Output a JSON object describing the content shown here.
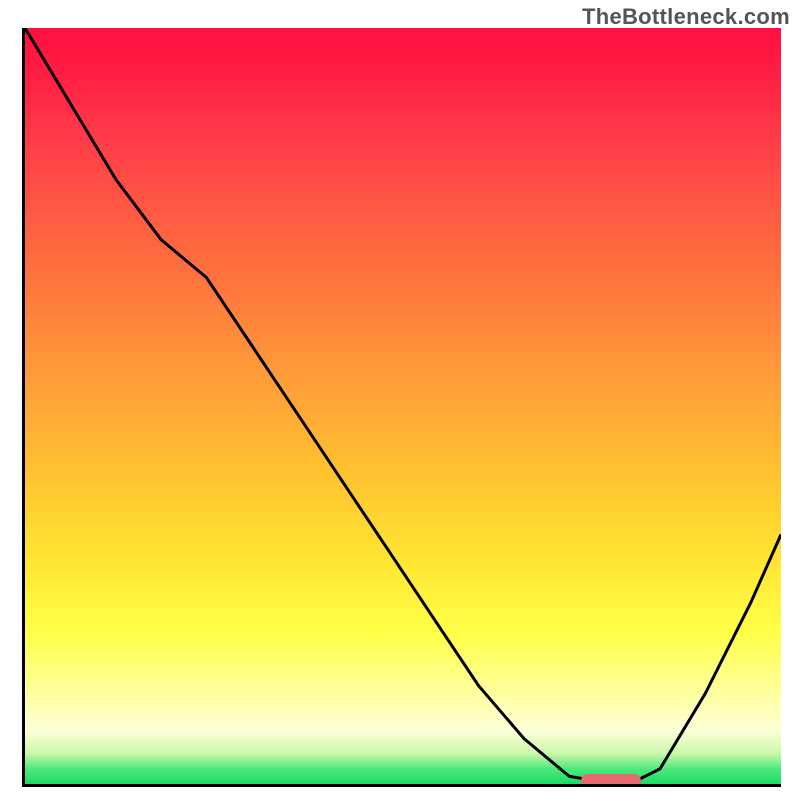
{
  "watermark": "TheBottleneck.com",
  "chart_data": {
    "type": "line",
    "title": "",
    "xlabel": "",
    "ylabel": "",
    "x": [
      0.0,
      0.06,
      0.12,
      0.18,
      0.24,
      0.3,
      0.36,
      0.42,
      0.48,
      0.54,
      0.6,
      0.66,
      0.72,
      0.78,
      0.8,
      0.84,
      0.9,
      0.96,
      1.0
    ],
    "values": [
      1.0,
      0.9,
      0.8,
      0.72,
      0.67,
      0.58,
      0.49,
      0.4,
      0.31,
      0.22,
      0.13,
      0.06,
      0.01,
      0.0,
      0.0,
      0.02,
      0.12,
      0.24,
      0.33
    ],
    "xlim": [
      0,
      1
    ],
    "ylim": [
      0,
      1
    ],
    "marker": {
      "x_start": 0.735,
      "x_end": 0.815,
      "y": 0.0
    },
    "annotations": []
  },
  "colors": {
    "curve": "#000000",
    "marker": "#e46a6e",
    "axis": "#000000"
  }
}
